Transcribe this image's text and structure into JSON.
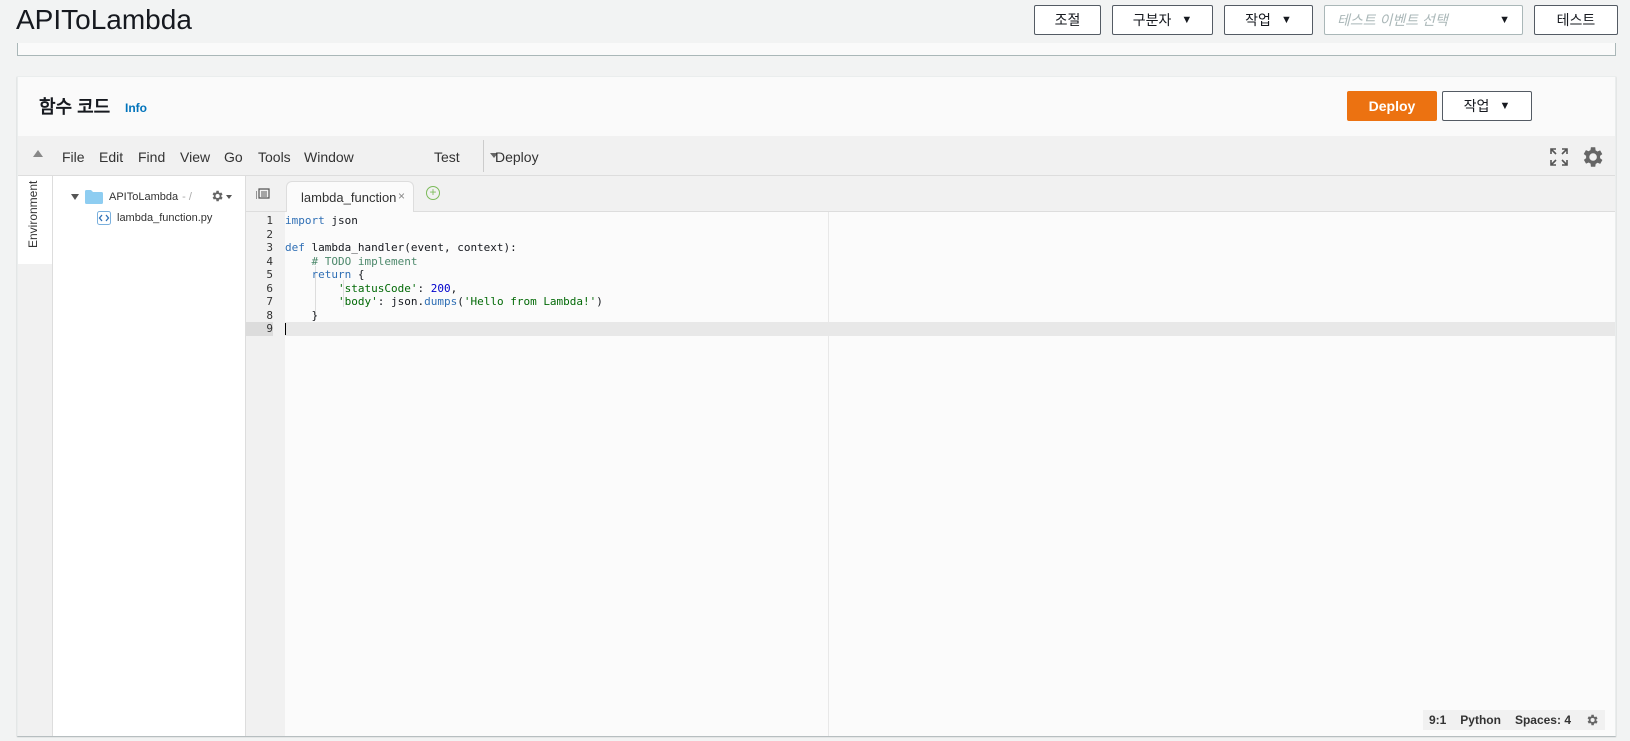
{
  "header": {
    "title": "APIToLambda",
    "buttons": {
      "throttle": "조절",
      "qualifiers": "구분자",
      "actions": "작업",
      "test_event_placeholder": "테스트 이벤트 선택",
      "test": "테스트"
    }
  },
  "panel": {
    "title": "함수 코드",
    "info": "Info",
    "deploy": "Deploy",
    "actions": "작업"
  },
  "ide": {
    "menu": [
      "File",
      "Edit",
      "Find",
      "View",
      "Go",
      "Tools",
      "Window"
    ],
    "run": "Test",
    "deploy": "Deploy",
    "environment_tab": "Environment",
    "tree": {
      "root": "APIToLambda",
      "root_suffix": "- /",
      "file": "lambda_function.py"
    },
    "tab": {
      "label": "lambda_function",
      "close": "×",
      "add": "+"
    },
    "code_lines": [
      "import json",
      "",
      "def lambda_handler(event, context):",
      "    # TODO implement",
      "    return {",
      "        'statusCode': 200,",
      "        'body': json.dumps('Hello from Lambda!')",
      "    }",
      ""
    ],
    "line_numbers": [
      "1",
      "2",
      "3",
      "4",
      "5",
      "6",
      "7",
      "8",
      "9"
    ],
    "status": {
      "cursor": "9:1",
      "language": "Python",
      "spaces": "Spaces: 4"
    }
  },
  "colors": {
    "accent": "#ec7211",
    "link": "#0073bb"
  }
}
